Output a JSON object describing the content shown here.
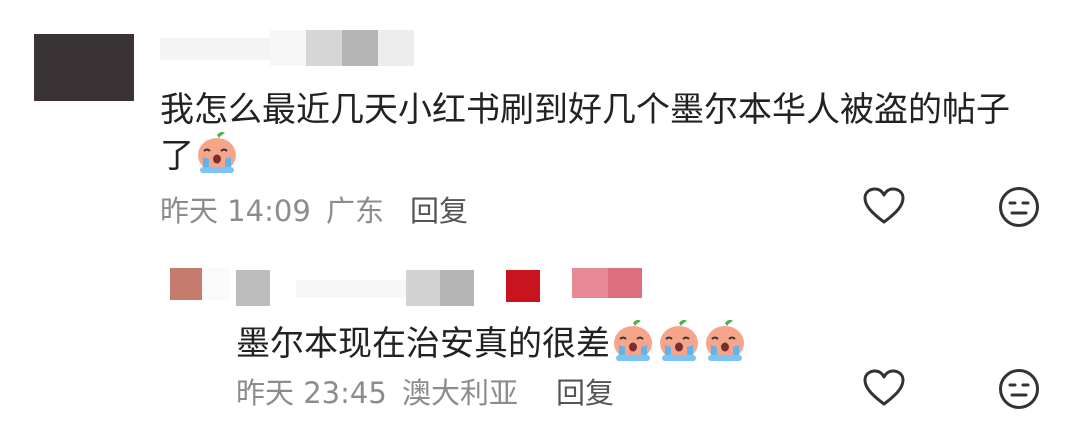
{
  "comment": {
    "text": "我怎么最近几天小红书刷到好几个墨尔本华人被盗的帖子",
    "text_line2": "了",
    "emoji": "cry-emoji",
    "time": "昨天 14:09",
    "location": "广东",
    "reply_label": "回复"
  },
  "reply": {
    "text": "墨尔本现在治安真的很差",
    "emoji": "cry-emoji",
    "emoji_count": 3,
    "time": "昨天 23:45",
    "location": "澳大利亚",
    "reply_label": "回复"
  },
  "icons": {
    "like": "heart-outline-icon",
    "dislike": "neutral-face-icon"
  },
  "colors": {
    "text": "#222222",
    "meta": "#8c8c8c",
    "mosaic_red": "#c8141e",
    "mosaic_pink": "#e88a96",
    "mosaic_brown": "#c47a6c"
  }
}
